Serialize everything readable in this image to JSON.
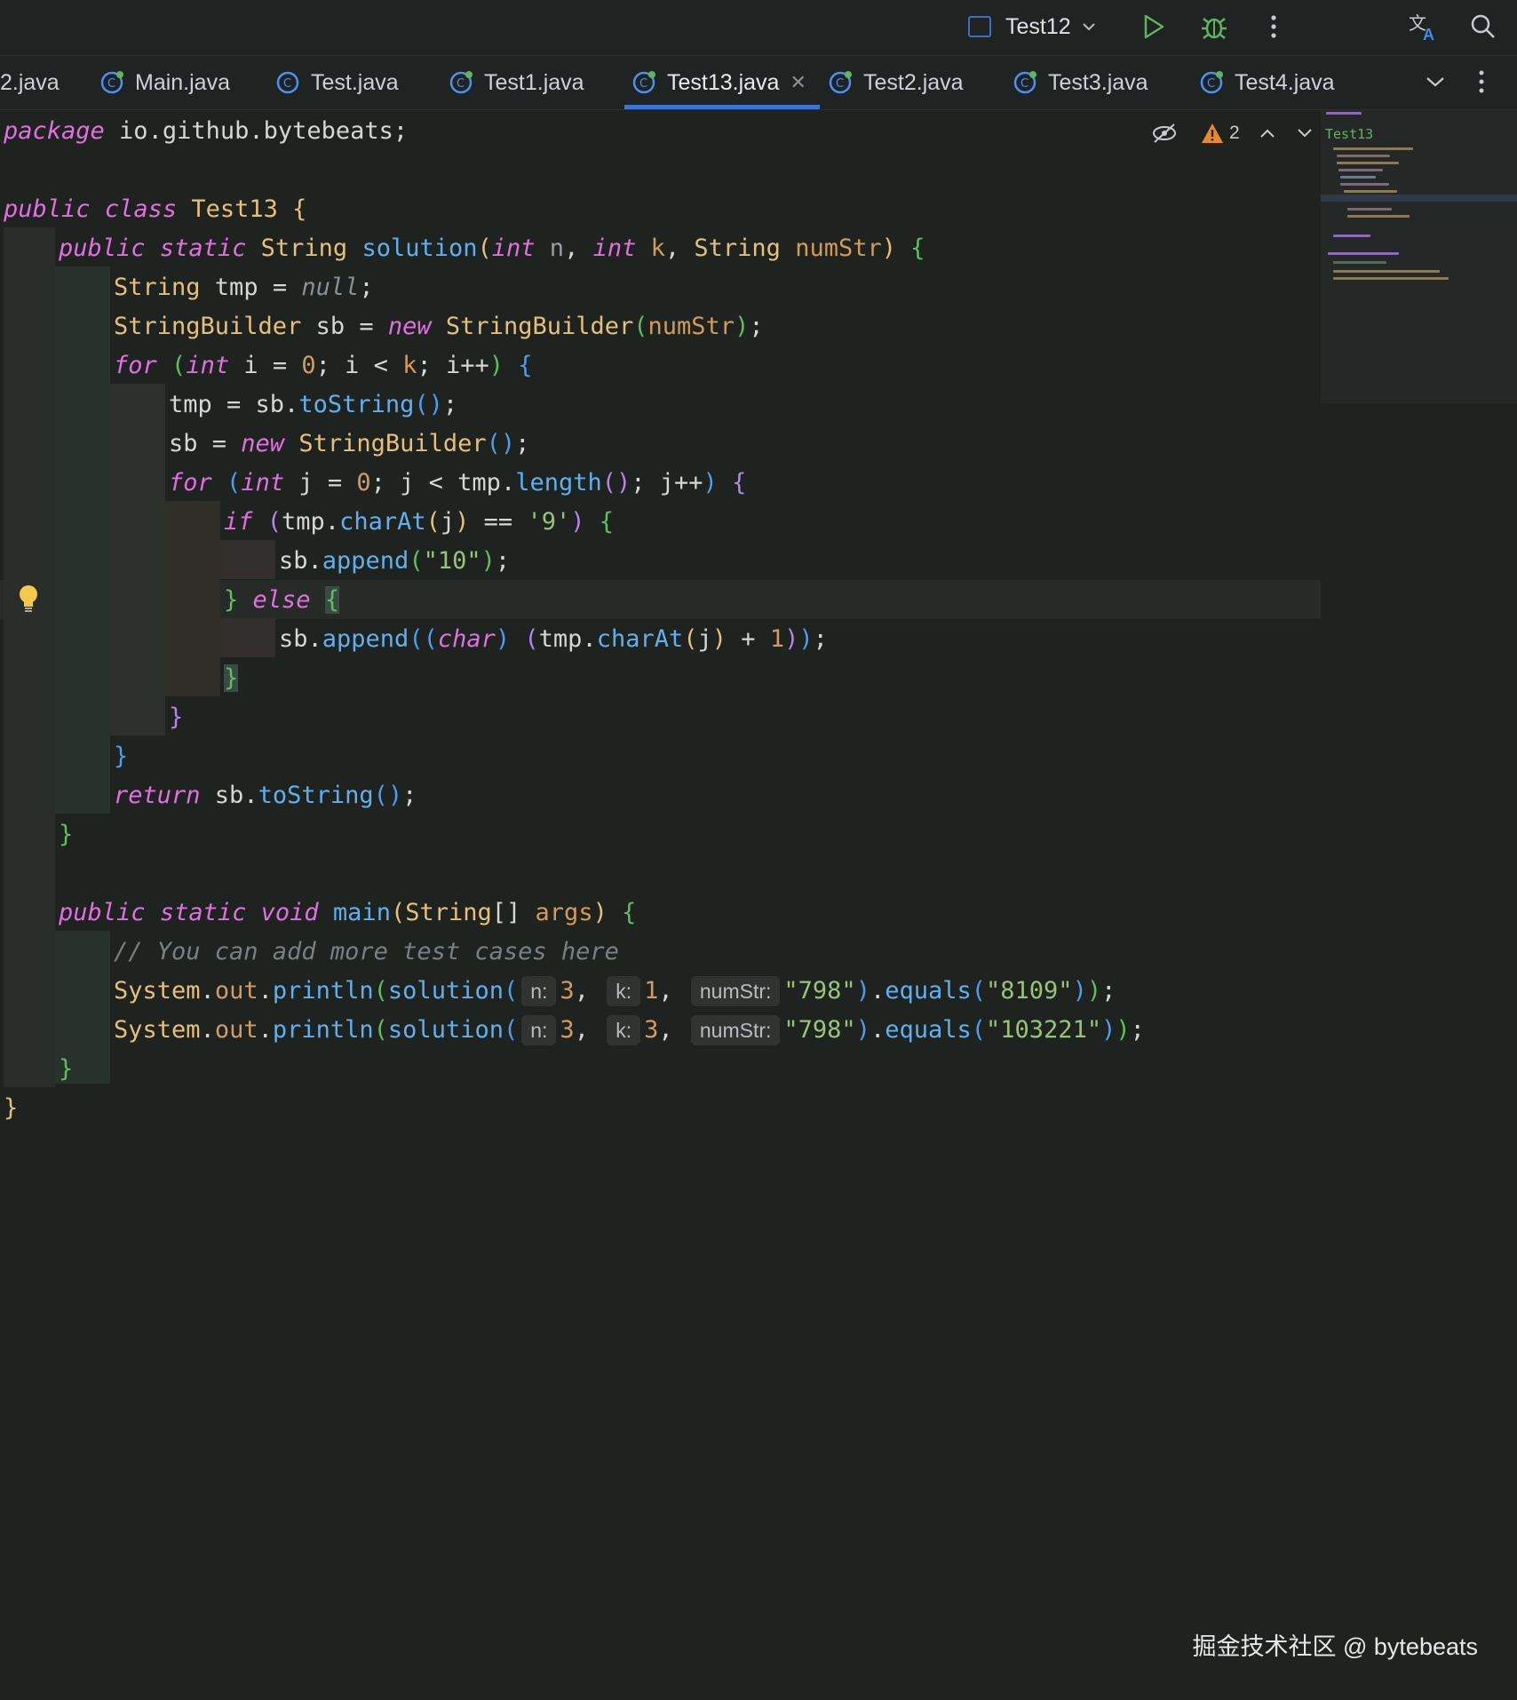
{
  "toolbar": {
    "run_config": "Test12",
    "run_icon": "play-icon",
    "debug_icon": "bug-icon",
    "more_icon": "kebab-icon",
    "translate_icon": "translate-icon",
    "search_icon": "search-icon"
  },
  "tabs": [
    {
      "label": "2.java"
    },
    {
      "label": "Main.java"
    },
    {
      "label": "Test.java"
    },
    {
      "label": "Test1.java"
    },
    {
      "label": "Test13.java",
      "active": true
    },
    {
      "label": "Test2.java"
    },
    {
      "label": "Test3.java"
    },
    {
      "label": "Test4.java"
    }
  ],
  "inspections": {
    "warning_count": "2"
  },
  "minimap": {
    "label": "Test13"
  },
  "code": {
    "l1": {
      "kw": "package",
      "rest": " io.github.bytebeats;"
    },
    "l3": {
      "kw1": "public",
      "kw2": "class",
      "name": "Test13",
      "brace": "{"
    },
    "l4": {
      "kw1": "public",
      "kw2": "static",
      "type1": "String",
      "fn": "solution",
      "p_open": "(",
      "kw3": "int",
      "n": "n",
      "kw4": "int",
      "k": "k",
      "type2": "String",
      "numStr": "numStr",
      "p_close": ")",
      "brace": "{"
    },
    "l5": {
      "type": "String",
      "rest": " tmp = ",
      "nul": "null",
      "end": ";"
    },
    "l6": {
      "type": "StringBuilder",
      "rest": " sb = ",
      "kw": "new",
      "type2": "StringBuilder",
      "arg": "numStr",
      "end": ";"
    },
    "l7": {
      "kw": "for",
      "kw2": "int",
      "mid1": " i = ",
      "num": "0",
      "mid2": "; i < ",
      "k": "k",
      "mid3": "; i++",
      "brace": "{"
    },
    "l8": {
      "pre": "tmp = sb.",
      "fn": "toString",
      "end": ";"
    },
    "l9": {
      "pre": "sb = ",
      "kw": "new",
      "type": "StringBuilder",
      "end": ";"
    },
    "l10": {
      "kw": "for",
      "kw2": "int",
      "mid1": " j = ",
      "num": "0",
      "mid2": "; j < tmp.",
      "fn": "length",
      "mid3": "; j++",
      "brace": "{"
    },
    "l11": {
      "kw": "if",
      "pre": "tmp.",
      "fn": "charAt",
      "arg": "j",
      "op": " == ",
      "str": "'9'",
      "brace": "{"
    },
    "l12": {
      "pre": "sb.",
      "fn": "append",
      "str": "\"10\"",
      "end": ";"
    },
    "l13": {
      "close": "}",
      "kw": "else",
      "brace": "{"
    },
    "l14": {
      "pre": "sb.",
      "fn": "append",
      "kw": "char",
      "mid": "tmp.",
      "fn2": "charAt",
      "arg": "j",
      "plus": " + ",
      "num": "1",
      "end": ";"
    },
    "l15": {
      "close": "}"
    },
    "l16": {
      "close": "}"
    },
    "l17": {
      "close": "}"
    },
    "l18": {
      "kw": "return",
      "pre": " sb.",
      "fn": "toString",
      "end": ";"
    },
    "l19": {
      "close": "}"
    },
    "l21": {
      "kw1": "public",
      "kw2": "static",
      "kw3": "void",
      "fn": "main",
      "type": "String",
      "arr": "[]",
      "arg": "args",
      "brace": "{"
    },
    "l22": {
      "comment": "// You can add more test cases here"
    },
    "l23": {
      "type": "System",
      "fld": "out",
      "fn": "println",
      "fn2": "solution",
      "h1": "n:",
      "v1": "3",
      "h2": "k:",
      "v2": "1",
      "h3": "numStr:",
      "str": "\"798\"",
      "fn3": "equals",
      "str2": "\"8109\"",
      "end": ";"
    },
    "l24": {
      "type": "System",
      "fld": "out",
      "fn": "println",
      "fn2": "solution",
      "h1": "n:",
      "v1": "3",
      "h2": "k:",
      "v2": "3",
      "h3": "numStr:",
      "str": "\"798\"",
      "fn3": "equals",
      "str2": "\"103221\"",
      "end": ";"
    },
    "l25": {
      "close": "}"
    },
    "l26": {
      "close": "}"
    }
  },
  "watermark": "掘金技术社区 @ bytebeats",
  "colors": {
    "background": "#1e2320",
    "keyword": "#e16fe0",
    "type": "#e6c07b",
    "function": "#61afef",
    "string": "#98c379",
    "accent": "#3d74d6"
  }
}
